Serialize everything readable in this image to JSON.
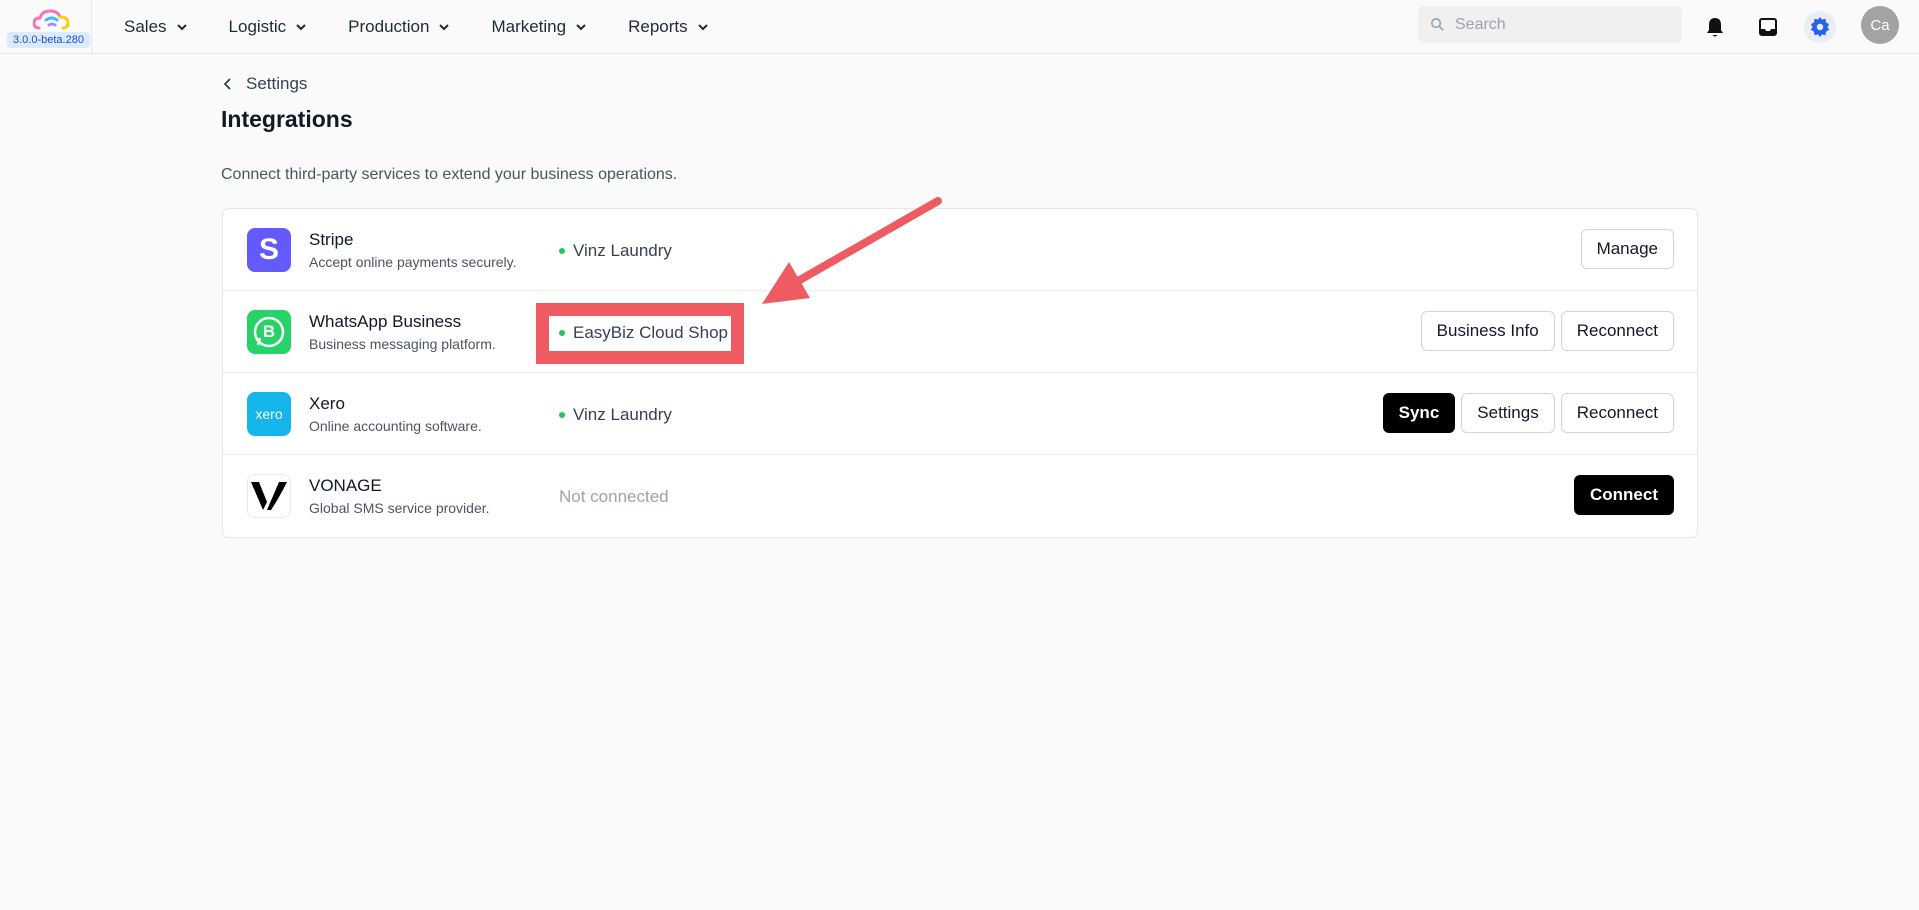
{
  "app": {
    "version": "3.0.0-beta.280"
  },
  "nav": {
    "items": [
      {
        "label": "Sales"
      },
      {
        "label": "Logistic"
      },
      {
        "label": "Production"
      },
      {
        "label": "Marketing"
      },
      {
        "label": "Reports"
      }
    ]
  },
  "search": {
    "placeholder": "Search",
    "value": ""
  },
  "user": {
    "initials": "Ca"
  },
  "breadcrumb": {
    "back_label": "Settings"
  },
  "page": {
    "title": "Integrations",
    "description": "Connect third-party services to extend your business operations."
  },
  "integrations": [
    {
      "name": "Stripe",
      "description": "Accept online payments securely.",
      "status": "Vinz Laundry",
      "connected": true,
      "actions": [
        "Manage"
      ],
      "logo_text": "S",
      "logo_color": "#635bff"
    },
    {
      "name": "WhatsApp Business",
      "description": "Business messaging platform.",
      "status": "EasyBiz Cloud Shop",
      "connected": true,
      "actions": [
        "Business Info",
        "Reconnect"
      ],
      "logo_text": "B",
      "logo_color": "#25d366"
    },
    {
      "name": "Xero",
      "description": "Online accounting software.",
      "status": "Vinz Laundry",
      "connected": true,
      "actions": [
        "Sync",
        "Settings",
        "Reconnect"
      ],
      "logo_text": "xero",
      "logo_color": "#13b5ea"
    },
    {
      "name": "VONAGE",
      "description": "Global SMS service provider.",
      "status": "Not connected",
      "connected": false,
      "actions": [
        "Connect"
      ],
      "logo_text": "V",
      "logo_color": "#000000"
    }
  ],
  "colors": {
    "annotation": "#ef5b63",
    "status_dot": "#22c55e",
    "primary_button": "#000000"
  },
  "icons": {
    "nav_chevron": "chevron-down-icon",
    "search": "search-icon",
    "notifications": "bell-icon",
    "inbox": "inbox-icon",
    "settings": "gear-icon",
    "back": "chevron-left-icon"
  }
}
